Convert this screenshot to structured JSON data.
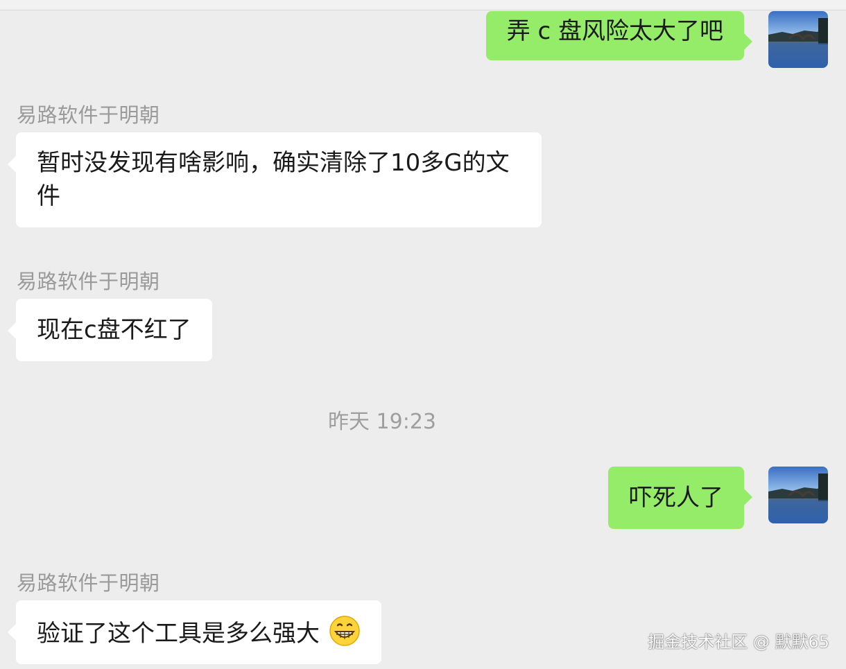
{
  "chat": {
    "messages": [
      {
        "sender": "",
        "text": "弄 c 盘风险太大了吧"
      },
      {
        "sender": "易路软件于明朝",
        "text": "暂时没发现有啥影响，确实清除了10多G的文件"
      },
      {
        "sender": "易路软件于明朝",
        "text": "现在c盘不红了"
      },
      {
        "timestamp": "昨天 19:23"
      },
      {
        "sender": "",
        "text": "吓死人了"
      },
      {
        "sender": "易路软件于明朝",
        "text": "验证了这个工具是多么强大",
        "emoji": "grinning-face-icon"
      }
    ]
  },
  "watermark": "掘金技术社区 @ 默默65",
  "colors": {
    "background": "#ededed",
    "outgoing_bubble": "#95ec69",
    "incoming_bubble": "#ffffff",
    "sender_name": "#9a9a9a"
  }
}
